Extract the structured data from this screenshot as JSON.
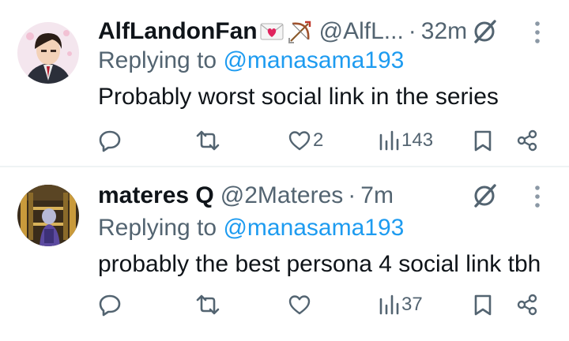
{
  "tweets": [
    {
      "name": "AlfLandonFan",
      "handle": "@AlfL...",
      "dot": "·",
      "time": "32m",
      "replying_prefix": "Replying to ",
      "replying_to": "@manasama193",
      "text": "Probably worst social link in the series",
      "reply_count": "",
      "retweet_count": "",
      "like_count": "2",
      "view_count": "143"
    },
    {
      "name": "materes Q",
      "handle": "@2Materes",
      "dot": "·",
      "time": "7m",
      "replying_prefix": "Replying to ",
      "replying_to": "@manasama193",
      "text": "probably the best persona 4 social link tbh",
      "reply_count": "",
      "retweet_count": "",
      "like_count": "",
      "view_count": "37"
    }
  ],
  "colors": {
    "text": "#0f1419",
    "secondary": "#536471",
    "link": "#1d9bf0",
    "divider": "#eff3f4"
  },
  "icons": [
    "reply-icon",
    "retweet-icon",
    "like-icon",
    "views-icon",
    "bookmark-icon",
    "share-icon",
    "grok-icon",
    "more-icon",
    "envelope-heart-emoji",
    "bow-arrow-emoji"
  ]
}
